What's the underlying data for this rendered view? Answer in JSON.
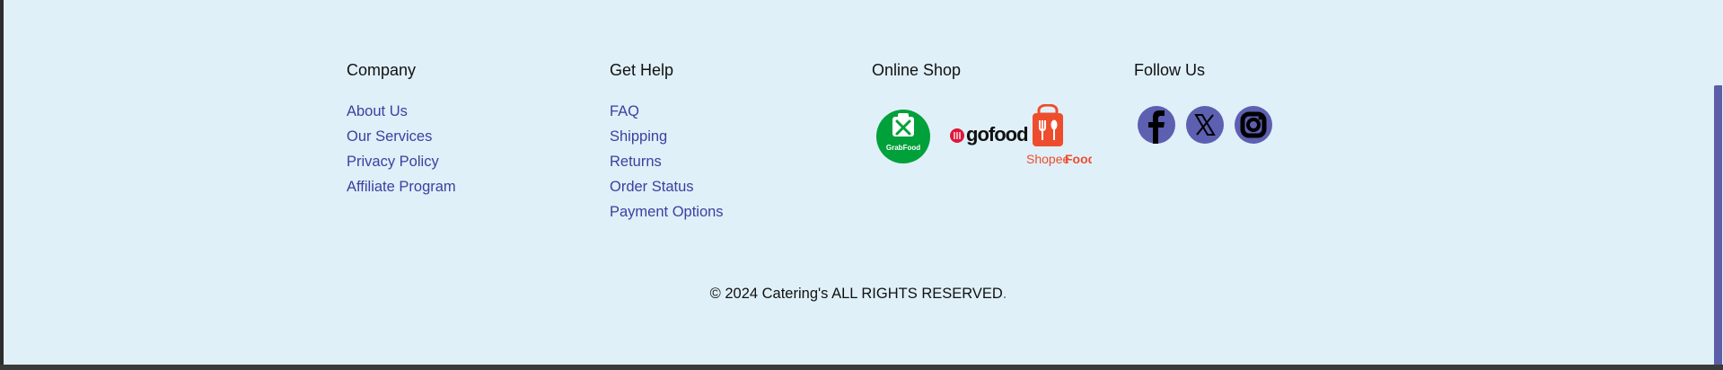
{
  "footer": {
    "company": {
      "heading": "Company",
      "links": [
        "About Us",
        "Our Services",
        "Privacy Policy",
        "Affiliate Program"
      ]
    },
    "help": {
      "heading": "Get Help",
      "links": [
        "FAQ",
        "Shipping",
        "Returns",
        "Order Status",
        "Payment Options"
      ]
    },
    "shop": {
      "heading": "Online Shop",
      "logos": {
        "grab": "GrabFood",
        "gofood": "gofood",
        "shopee_prefix": "Shopee",
        "shopee_suffix": "Food"
      }
    },
    "social": {
      "heading": "Follow Us",
      "icons": [
        "facebook-icon",
        "x-icon",
        "instagram-icon"
      ]
    },
    "copyright": {
      "text": "© 2024 Catering's ALL RIGHTS RESERVED",
      "dot": "."
    }
  },
  "colors": {
    "background": "#dff0f8",
    "link": "#3d3fa0",
    "accent": "#5b5ea6",
    "grab": "#00a13a",
    "gofood_red": "#e0173a",
    "shopee": "#ee4d2d"
  }
}
